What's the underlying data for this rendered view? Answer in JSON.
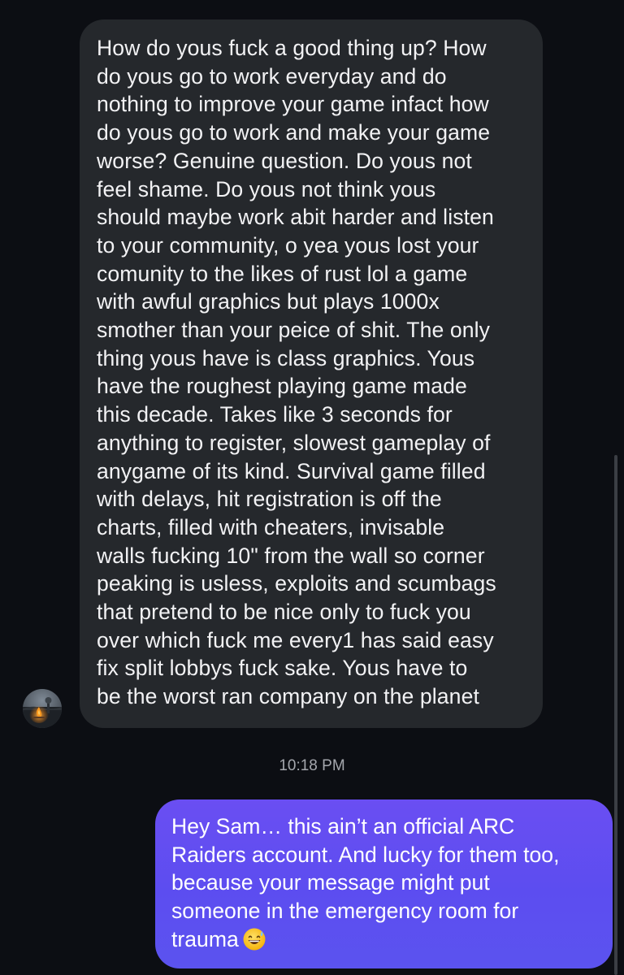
{
  "conversation": {
    "incoming_message": {
      "text": "How do yous fuck a good thing up? How\ndo yous go to work everyday and do\nnothing to improve your game infact how\ndo yous go to work and make your game\nworse? Genuine question. Do yous not\nfeel shame. Do yous not think yous\nshould maybe work abit harder and listen\nto your community, o yea yous lost your\ncomunity to the likes of rust lol a game\nwith awful graphics but plays 1000x\nsmother than your peice of shit. The only\nthing yous have is class graphics. Yous\nhave the roughest playing game made\nthis decade. Takes like 3 seconds for\nanything to register, slowest gameplay of\nanygame of its kind. Survival game filled\nwith delays, hit registration is off the\ncharts, filled with cheaters, invisable\nwalls fucking 10\" from the wall so corner\npeaking is usless, exploits and scumbags\nthat pretend to be nice only to fuck you\nover which fuck me every1 has said easy\nfix split lobbys fuck sake. Yous have to\nbe the worst ran company on the planet",
      "avatar_icon": "campfire-avatar-icon"
    },
    "timestamp": "10:18 PM",
    "outgoing_message": {
      "text": "Hey Sam… this ain’t an official ARC\nRaiders account. And lucky for them too,\nbecause your message might put\nsomeone in the emergency room for\ntrauma",
      "emoji_icon": "grinning-sweat-emoji"
    },
    "colors": {
      "background": "#0c0e13",
      "incoming_bubble": "#25282c",
      "outgoing_bubble": "#5c4df0",
      "timestamp_text": "#a4a7ad"
    }
  }
}
